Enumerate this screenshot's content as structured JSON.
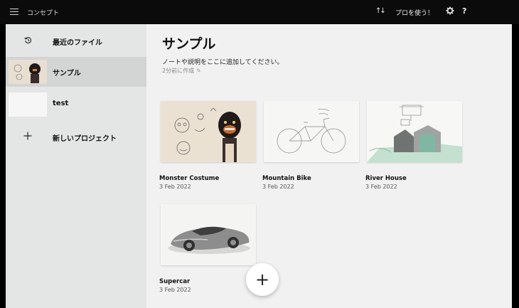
{
  "header": {
    "title": "コンセプト",
    "sort_icon": "↑↓",
    "pro_label": "プロを使う！",
    "help_label": "?"
  },
  "sidebar": {
    "items": [
      {
        "label": "最近のファイル",
        "icon": "clock-history-icon"
      },
      {
        "label": "サンプル",
        "icon": "sample-thumbnail"
      },
      {
        "label": "test",
        "icon": "blank-thumbnail"
      },
      {
        "label": "新しいプロジェクト",
        "icon": "plus-icon"
      }
    ]
  },
  "main": {
    "title": "サンプル",
    "description": "ノートや説明をここに追加してください。",
    "meta": "2分前に作成",
    "cards": [
      {
        "title": "Monster Costume",
        "date": "3 Feb 2022"
      },
      {
        "title": "Mountain Bike",
        "date": "3 Feb 2022"
      },
      {
        "title": "River House",
        "date": "3 Feb 2022"
      },
      {
        "title": "Supercar",
        "date": "3 Feb 2022"
      }
    ],
    "fab_label": "+"
  }
}
